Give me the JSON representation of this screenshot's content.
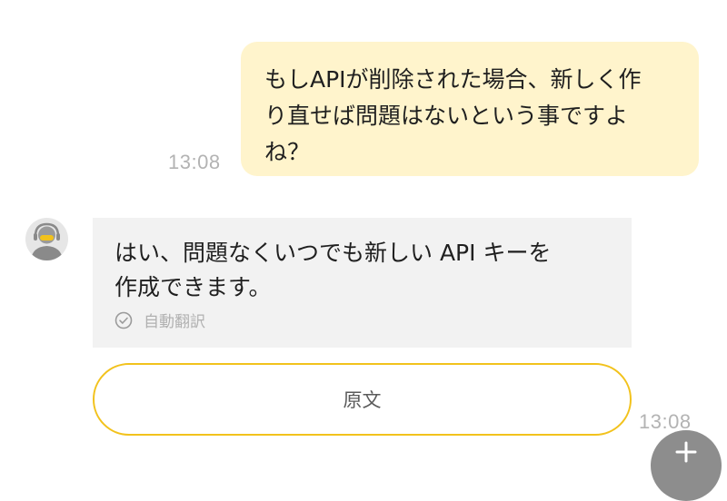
{
  "messages": {
    "user": {
      "text": "もしAPIが削除された場合、新しく作\nり直せば問題はないという事ですよ\nね？",
      "time": "13:08"
    },
    "bot": {
      "avatar_icon": "assistant-avatar-icon",
      "text": "はい、問題なくいつでも新しい API キーを\n作成できます。",
      "translation_label": "自動翻訳",
      "translation_icon": "check-circle-icon",
      "original_button_label": "原文",
      "time": "13:08"
    }
  },
  "fab": {
    "icon": "plus-icon"
  },
  "colors": {
    "user_bubble": "#fff4cc",
    "bot_bubble": "#f2f2f2",
    "accent_border": "#f2c21c",
    "timestamp": "#b3b3b3"
  }
}
